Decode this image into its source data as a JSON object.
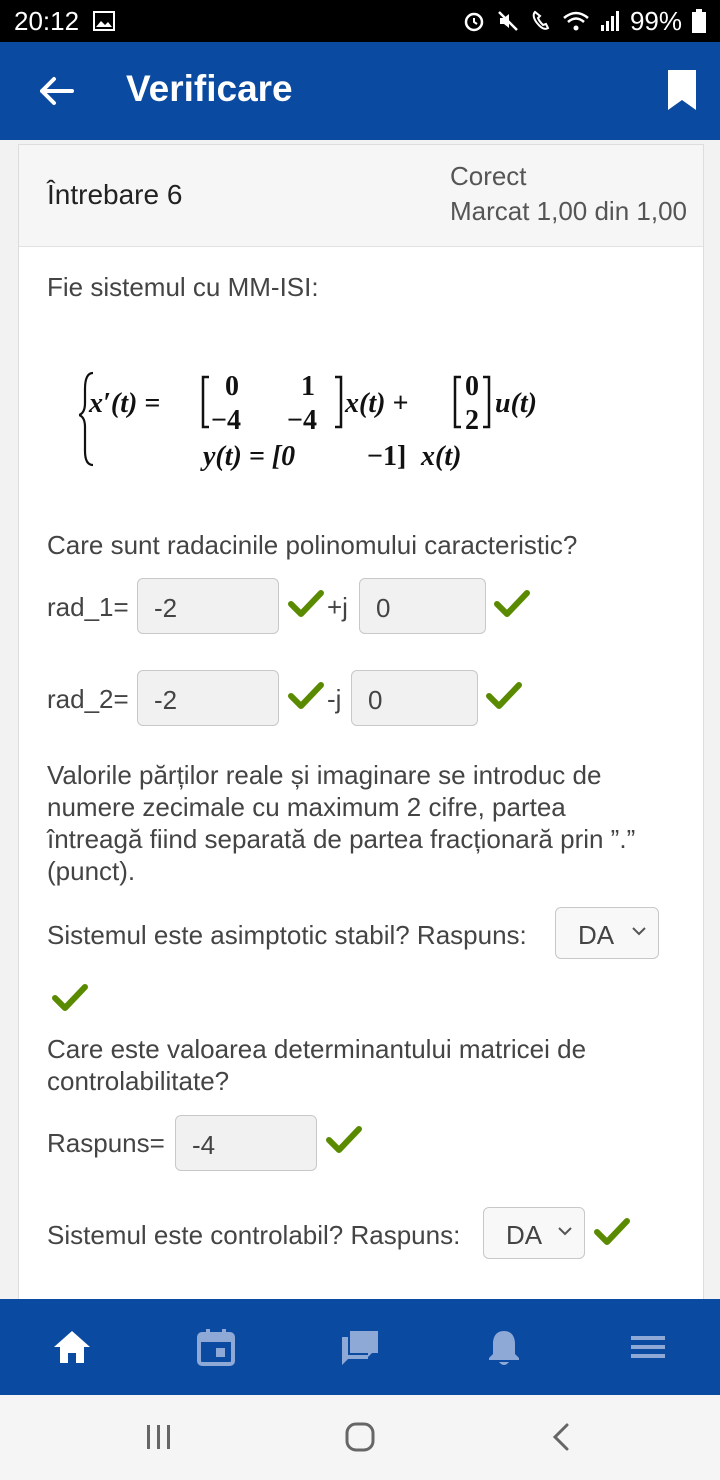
{
  "status_bar": {
    "time": "20:12",
    "battery": "99%"
  },
  "app_bar": {
    "title": "Verificare"
  },
  "question": {
    "name": "Întrebare 6",
    "state_line1": "Corect",
    "state_line2": "Marcat 1,00 din 1,00",
    "intro": "Fie sistemul cu MM-ISI:",
    "formula": {
      "line1_lhs": "x′(t) =",
      "A": [
        [
          "0",
          "1"
        ],
        [
          "−4",
          "−4"
        ]
      ],
      "mid": "x(t) +",
      "B": [
        "0",
        "2"
      ],
      "line1_end": "u(t)",
      "line2_lhs": "y(t) = [0",
      "line2_c2": "−1]",
      "line2_end": "x(t)"
    },
    "roots_prompt": "Care sunt radacinile polinomului caracteristic?",
    "rad1_label": "rad_1=",
    "rad1_real": "-2",
    "rad1_sign": "+j",
    "rad1_imag": "0",
    "rad2_label": "rad_2=",
    "rad2_real": "-2",
    "rad2_sign": "-j",
    "rad2_imag": "0",
    "note_lines": [
      "Valorile părților reale și imaginare se introduc de",
      "numere zecimale cu maximum 2 cifre, partea",
      "întreagă fiind separată de partea fracționară prin ”.”",
      "(punct)."
    ],
    "stable_prompt": "Sistemul este asimptotic stabil? Raspuns:",
    "stable_answer": "DA",
    "det_prompt_line1": "Care este valoarea determinantului matricei de",
    "det_prompt_line2": "controlabilitate?",
    "det_label": "Raspuns=",
    "det_answer": "-4",
    "ctrl_prompt": "Sistemul este controlabil? Raspuns:",
    "ctrl_answer": "DA"
  },
  "colors": {
    "brand": "#0a4aa0",
    "check": "#5a8a00"
  },
  "bottom_nav": [
    "home-icon",
    "calendar-icon",
    "messages-icon",
    "notifications-icon",
    "menu-icon"
  ]
}
